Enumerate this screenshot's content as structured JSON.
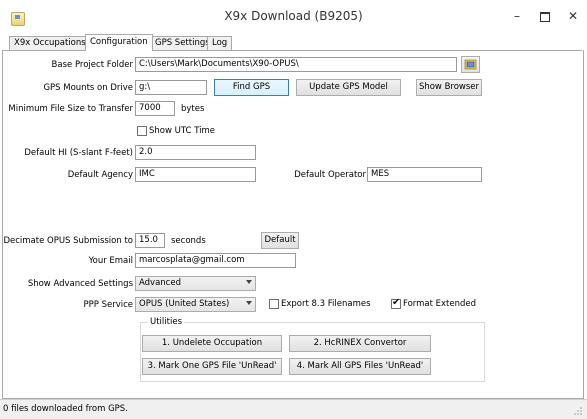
{
  "window": {
    "title": "X9x Download  (B9205)",
    "minimize_glyph": "–",
    "close_glyph": "✕"
  },
  "tabs": [
    {
      "label": "X9x Occupations",
      "active": false
    },
    {
      "label": "Configuration",
      "active": true
    },
    {
      "label": "GPS Settings",
      "active": false
    },
    {
      "label": "Log",
      "active": false
    }
  ],
  "config": {
    "base_project_folder": {
      "label": "Base Project Folder",
      "value": "C:\\Users\\Mark\\Documents\\X90-OPUS\\"
    },
    "gps_mounts": {
      "label": "GPS Mounts on Drive",
      "value": "g:\\"
    },
    "find_gps_label": "Find GPS",
    "update_gps_model_label": "Update GPS Model",
    "show_browser_label": "Show Browser",
    "max_file_size": {
      "label": "Minimum File Size to Transfer",
      "value": "7000",
      "unit": "bytes"
    },
    "show_utc": {
      "label": "Show UTC Time",
      "checked": false
    },
    "default_hi": {
      "label": "Default HI (S-slant F-feet)",
      "value": "2.0"
    },
    "default_agency": {
      "label": "Default Agency",
      "value": "IMC"
    },
    "default_operator": {
      "label": "Default Operator",
      "value": "MES"
    },
    "decimate": {
      "label": "Decimate OPUS Submission to",
      "value": "15.0",
      "unit": "seconds"
    },
    "default_button_label": "Default",
    "email": {
      "label": "Your Email",
      "value": "marcosplata@gmail.com"
    },
    "advanced_settings": {
      "label": "Show Advanced Settings",
      "value": "Advanced"
    },
    "ppp_service": {
      "label": "PPP Service",
      "value": "OPUS (United States)"
    },
    "export_83": {
      "label": "Export 8.3 Filenames",
      "checked": false
    },
    "format_extended": {
      "label": "Format Extended",
      "checked": true
    }
  },
  "utilities": {
    "title": "Utilities",
    "buttons": [
      "1. Undelete Occupation",
      "2. HcRINEX Convertor",
      "3. Mark One GPS File 'UnRead'",
      "4. Mark All GPS Files 'UnRead'"
    ]
  },
  "status": {
    "text": "0 files downloaded from GPS."
  }
}
